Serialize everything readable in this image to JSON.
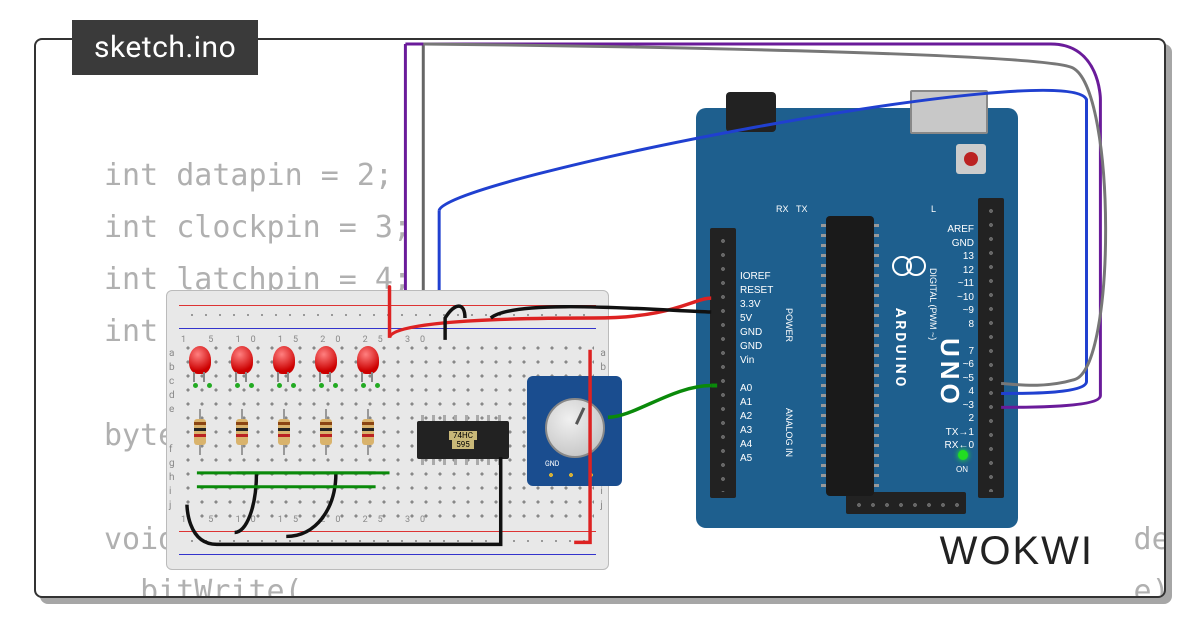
{
  "tab": {
    "filename": "sketch.ino"
  },
  "code": {
    "lines": [
      "int datapin = 2;",
      "int clockpin = 3;",
      "int latchpin = 4;",
      "int poten",
      "",
      "byte data",
      "",
      "void shift                                               desiredState){",
      "  bitWrite(                                              e);"
    ]
  },
  "logo": "WOKWI",
  "chip": {
    "label1": "74HC",
    "label2": "595"
  },
  "potentiometer": {
    "label": "GND"
  },
  "arduino": {
    "board_label": "ARDUINO",
    "model": "UNO",
    "power_group": "POWER",
    "analog_group": "ANALOG IN",
    "digital_group": "DIGITAL (PWM ~)",
    "left_pins": "IOREF\nRESET\n3.3V\n5V\nGND\nGND\nVin\n\nA0\nA1\nA2\nA3\nA4\nA5",
    "right_pins": "AREF\nGND\n13\n12\n~11\n~10\n~9\n8\n\n7\n~6\n~5\n4\n~3\n2\nTX→1\nRX←0",
    "tx": "TX",
    "rx": "RX",
    "L": "L",
    "on": "ON"
  },
  "breadboard": {
    "col_numbers": "1      5         10        15        20        25        30",
    "row_letters_top": "a\nb\nc\nd\ne",
    "row_letters_bot": "f\ng\nh\ni\nj"
  },
  "components": {
    "leds": 5,
    "resistors": 5,
    "shift_register": "74HC595",
    "potentiometer": 1,
    "arduino_uno": 1
  },
  "wiring": {
    "datapin": 2,
    "clockpin": 3,
    "latchpin": 4,
    "colors": [
      "red",
      "black",
      "green",
      "purple",
      "blue",
      "gray"
    ]
  }
}
